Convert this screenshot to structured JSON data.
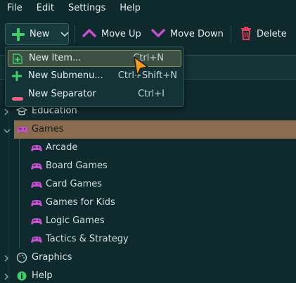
{
  "menubar": {
    "items": [
      "File",
      "Edit",
      "Settings",
      "Help"
    ]
  },
  "toolbar": {
    "new_label": "New",
    "move_up_label": "Move Up",
    "move_down_label": "Move Down",
    "delete_label": "Delete"
  },
  "new_menu": {
    "items": [
      {
        "label": "New Item...",
        "shortcut": "Ctrl+N",
        "icon": "new-item-icon"
      },
      {
        "label": "New Submenu...",
        "shortcut": "Ctrl+Shift+N",
        "icon": "plus-icon"
      },
      {
        "label": "New Separator",
        "shortcut": "Ctrl+I",
        "icon": "separator-icon"
      }
    ]
  },
  "tree": {
    "items": [
      {
        "label": "Education",
        "icon": "education-icon",
        "expanded": false
      },
      {
        "label": "Games",
        "icon": "gamepad-icon",
        "expanded": true,
        "selected": true
      },
      {
        "label": "Arcade",
        "icon": "gamepad-icon"
      },
      {
        "label": "Board Games",
        "icon": "gamepad-icon"
      },
      {
        "label": "Card Games",
        "icon": "gamepad-icon"
      },
      {
        "label": "Games for Kids",
        "icon": "gamepad-icon"
      },
      {
        "label": "Logic Games",
        "icon": "gamepad-icon"
      },
      {
        "label": "Tactics & Strategy",
        "icon": "gamepad-icon"
      },
      {
        "label": "Graphics",
        "icon": "palette-icon",
        "expanded": false
      },
      {
        "label": "Help",
        "icon": "help-icon",
        "expanded": false
      }
    ]
  },
  "colors": {
    "accent": "#c44fd0",
    "add": "#3fcf6a",
    "delete": "#e0405f",
    "selected_row": "#8b6c4f",
    "background": "#0f2a2d"
  }
}
